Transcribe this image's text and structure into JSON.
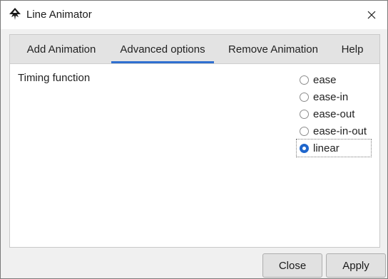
{
  "window": {
    "title": "Line Animator",
    "app_icon": "inkscape-icon",
    "close_icon": "close-icon"
  },
  "tabs": [
    {
      "label": "Add Animation",
      "active": false
    },
    {
      "label": "Advanced options",
      "active": true
    },
    {
      "label": "Remove Animation",
      "active": false
    },
    {
      "label": "Help",
      "active": false
    }
  ],
  "timing": {
    "label": "Timing function",
    "options": [
      {
        "label": "ease",
        "checked": false
      },
      {
        "label": "ease-in",
        "checked": false
      },
      {
        "label": "ease-out",
        "checked": false
      },
      {
        "label": "ease-in-out",
        "checked": false
      },
      {
        "label": "linear",
        "checked": true
      }
    ]
  },
  "buttons": {
    "close_label": "Close",
    "apply_label": "Apply"
  },
  "colors": {
    "accent": "#2f6fd0",
    "titlebar": "#ffffff",
    "background": "#f0f0f0"
  }
}
